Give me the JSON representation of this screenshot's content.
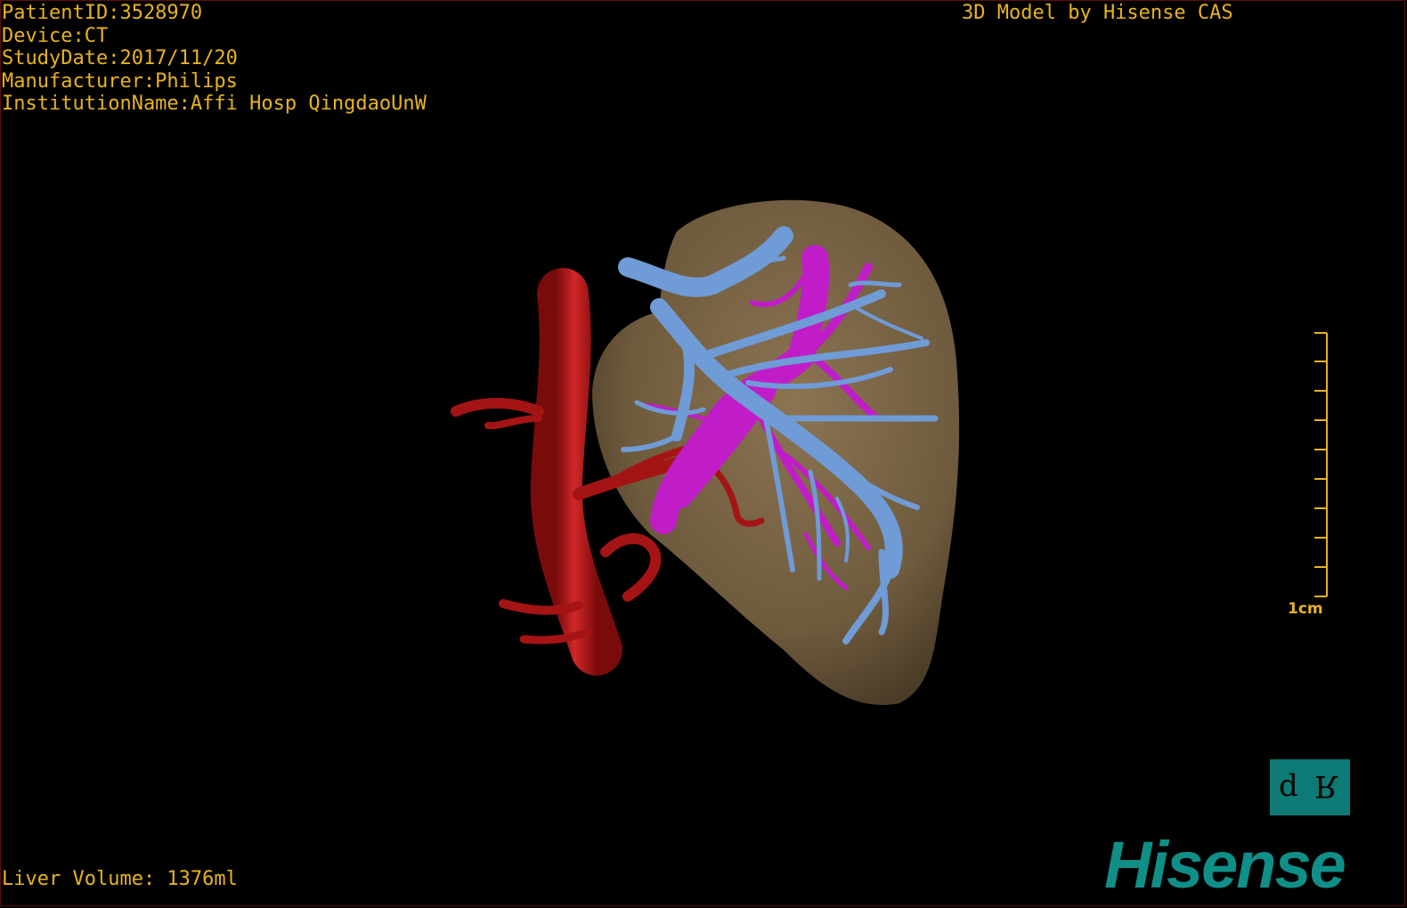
{
  "patient_info": {
    "patient_id": "PatientID:3528970",
    "device": "Device:CT",
    "study_date": "StudyDate:2017/11/20",
    "manufacturer": "Manufacturer:Philips",
    "institution": "InstitutionName:Affi Hosp QingdaoUnW"
  },
  "header_right": "3D Model by Hisense CAS",
  "footer": {
    "liver_volume": "Liver Volume: 1376ml"
  },
  "scale": {
    "label": "1cm",
    "ticks": 10
  },
  "orientation_cube": {
    "left_letter": "d",
    "right_letter": "R"
  },
  "logo": "Hisense",
  "colors": {
    "overlay_text": "#e8b320",
    "liver": "#7a6444",
    "portal_vein": "#6f9bd6",
    "hepatic_vein": "#c01dc8",
    "aorta": "#b21515",
    "brand": "#0f8f87"
  }
}
